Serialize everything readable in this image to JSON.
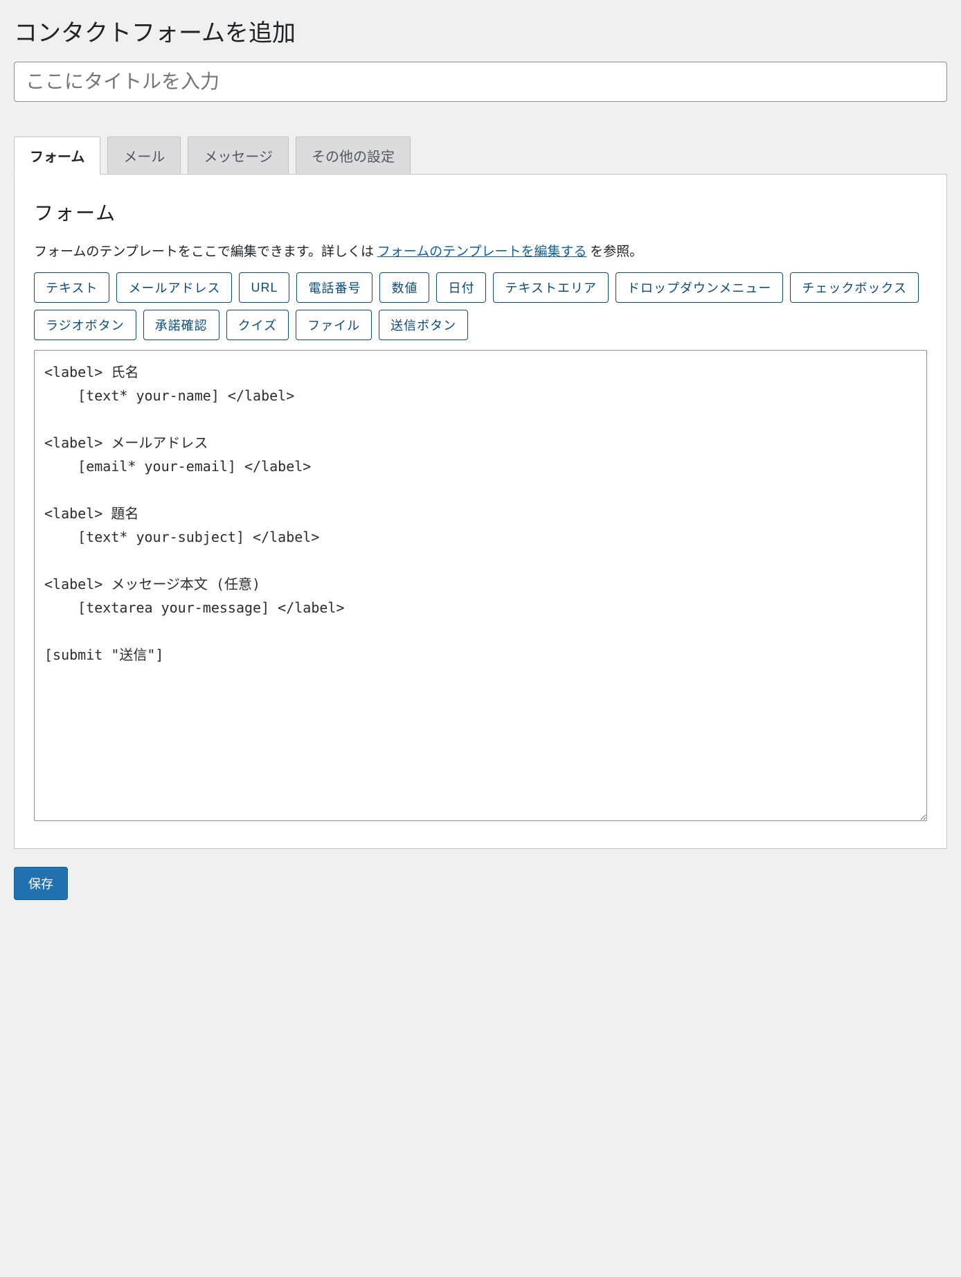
{
  "page_title": "コンタクトフォームを追加",
  "title_placeholder": "ここにタイトルを入力",
  "tabs": {
    "form": "フォーム",
    "mail": "メール",
    "messages": "メッセージ",
    "other": "その他の設定"
  },
  "panel": {
    "heading": "フォーム",
    "desc_pre": "フォームのテンプレートをここで編集できます。詳しくは",
    "desc_link": "フォームのテンプレートを編集する",
    "desc_post": "を参照。"
  },
  "tags": {
    "text": "テキスト",
    "email": "メールアドレス",
    "url": "URL",
    "tel": "電話番号",
    "number": "数値",
    "date": "日付",
    "textarea": "テキストエリア",
    "dropdown": "ドロップダウンメニュー",
    "checkbox": "チェックボックス",
    "radio": "ラジオボタン",
    "acceptance": "承諾確認",
    "quiz": "クイズ",
    "file": "ファイル",
    "submit": "送信ボタン"
  },
  "form_template": "<label> 氏名\n    [text* your-name] </label>\n\n<label> メールアドレス\n    [email* your-email] </label>\n\n<label> 題名\n    [text* your-subject] </label>\n\n<label> メッセージ本文 (任意)\n    [textarea your-message] </label>\n\n[submit \"送信\"]",
  "save_label": "保存"
}
